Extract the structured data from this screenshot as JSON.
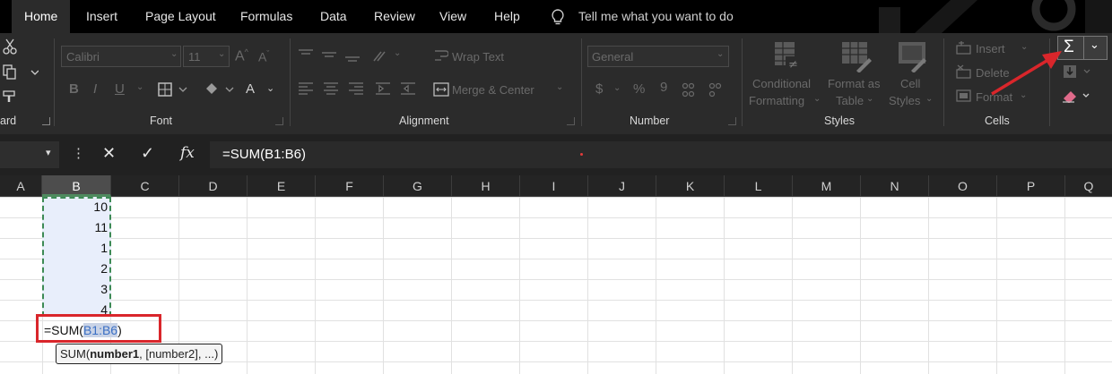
{
  "tabs": [
    {
      "label": "Home",
      "active": true
    },
    {
      "label": "Insert"
    },
    {
      "label": "Page Layout"
    },
    {
      "label": "Formulas"
    },
    {
      "label": "Data"
    },
    {
      "label": "Review"
    },
    {
      "label": "View"
    },
    {
      "label": "Help"
    }
  ],
  "tell_me": "Tell me what you want to do",
  "ribbon": {
    "clipboard_label": "ard",
    "font": {
      "name": "Calibri",
      "size": "11",
      "group_label": "Font"
    },
    "alignment": {
      "wrap_text": "Wrap Text",
      "merge_center": "Merge & Center",
      "group_label": "Alignment"
    },
    "number": {
      "format": "General",
      "currency": "$",
      "percent": "%",
      "comma": "9",
      "group_label": "Number"
    },
    "styles": {
      "conditional_formatting_1": "Conditional",
      "conditional_formatting_2": "Formatting",
      "format_as_table_1": "Format as",
      "format_as_table_2": "Table",
      "cell_styles_1": "Cell",
      "cell_styles_2": "Styles",
      "group_label": "Styles"
    },
    "cells": {
      "insert": "Insert",
      "delete": "Delete",
      "format": "Format",
      "group_label": "Cells"
    },
    "editing": {
      "autosum_symbol": "Σ"
    }
  },
  "formula_bar": {
    "cancel": "✕",
    "enter": "✓",
    "fx": "fx",
    "formula": "=SUM(B1:B6)"
  },
  "columns": [
    "A",
    "B",
    "C",
    "D",
    "E",
    "F",
    "G",
    "H",
    "I",
    "J",
    "K",
    "L",
    "M",
    "N",
    "O",
    "P",
    "Q"
  ],
  "selected_column": "B",
  "cells_b": [
    "10",
    "11",
    "1",
    "2",
    "3",
    "4"
  ],
  "edit_cell": {
    "prefix": "=SUM(",
    "ref": "B1:B6",
    "suffix": ")"
  },
  "tooltip": {
    "fn": "SUM(",
    "arg1": "number1",
    "rest": ", [number2], ...)"
  },
  "colors": {
    "accent_green": "#4f8a5f",
    "highlight_red": "#d9262b",
    "range_blue": "#3a6fc4"
  }
}
